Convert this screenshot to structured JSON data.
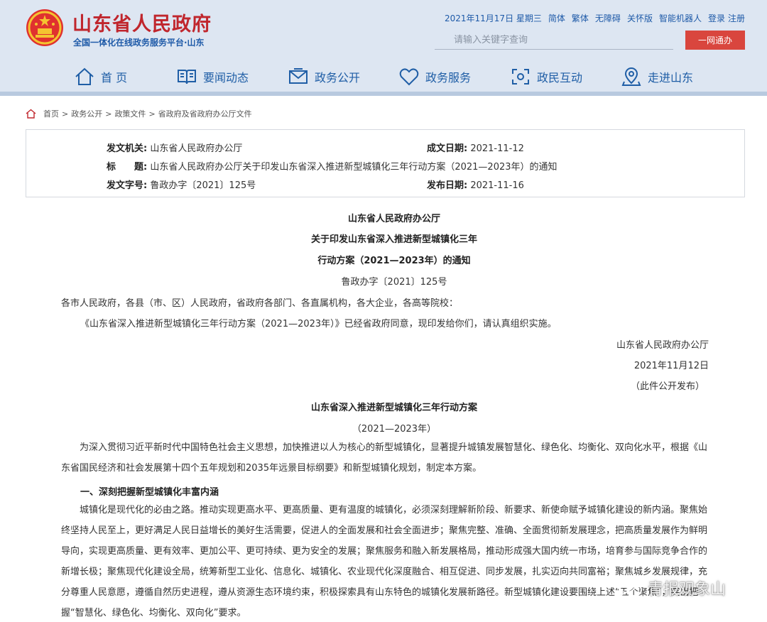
{
  "header": {
    "site_title": "山东省人民政府",
    "site_subtitle": "全国一体化在线政务服务平台·山东",
    "date": "2021年11月17日 星期三",
    "links": [
      "简体",
      "繁体",
      "无障碍",
      "关怀版",
      "智能机器人",
      "登录",
      "注册"
    ],
    "search_placeholder": "请输入关键字查询",
    "yiwang_label": "一网通办"
  },
  "nav": {
    "items": [
      {
        "label": "首 页",
        "icon": "home-icon"
      },
      {
        "label": "要闻动态",
        "icon": "book-icon"
      },
      {
        "label": "政务公开",
        "icon": "envelope-icon"
      },
      {
        "label": "政务服务",
        "icon": "heart-icon"
      },
      {
        "label": "政民互动",
        "icon": "interaction-icon"
      },
      {
        "label": "走进山东",
        "icon": "location-pin-icon"
      }
    ]
  },
  "breadcrumb": [
    "首页",
    "政务公开",
    "政策文件",
    "省政府及省政府办公厅文件"
  ],
  "breadcrumb_sep": ">",
  "info": {
    "issuer_label": "发文机关:",
    "issuer": "山东省人民政府办公厅",
    "date_label": "成文日期:",
    "date": "2021-11-12",
    "title_label": "标　　题:",
    "title": "山东省人民政府办公厅关于印发山东省深入推进新型城镇化三年行动方案（2021—2023年）的通知",
    "number_label": "发文字号:",
    "number": "鲁政办字〔2021〕125号",
    "publish_label": "发布日期:",
    "publish_date": "2021-11-16"
  },
  "document": {
    "heading1": "山东省人民政府办公厅",
    "heading2": "关于印发山东省深入推进新型城镇化三年",
    "heading3": "行动方案（2021—2023年）的通知",
    "doc_number": "鲁政办字〔2021〕125号",
    "recipients": "各市人民政府，各县（市、区）人民政府，省政府各部门、各直属机构，各大企业，各高等院校：",
    "notice": "《山东省深入推进新型城镇化三年行动方案（2021—2023年）》已经省政府同意，现印发给你们，请认真组织实施。",
    "signature": "山东省人民政府办公厅",
    "sign_date": "2021年11月12日",
    "public_note": "（此件公开发布）",
    "plan_title": "山东省深入推进新型城镇化三年行动方案",
    "plan_years": "（2021—2023年）",
    "intro": "为深入贯彻习近平新时代中国特色社会主义思想，加快推进以人为核心的新型城镇化，显著提升城镇发展智慧化、绿色化、均衡化、双向化水平，根据《山东省国民经济和社会发展第十四个五年规划和2035年远景目标纲要》和新型城镇化规划，制定本方案。",
    "section1": "一、深刻把握新型城镇化丰富内涵",
    "section1_body": "城镇化是现代化的必由之路。推动实现更高水平、更高质量、更有温度的城镇化，必须深刻理解新阶段、新要求、新使命赋予城镇化建设的新内涵。聚焦始终坚持人民至上，更好满足人民日益增长的美好生活需要，促进人的全面发展和社会全面进步；聚焦完整、准确、全面贯彻新发展理念，把高质量发展作为鲜明导向，实现更高质量、更有效率、更加公平、更可持续、更为安全的发展；聚焦服务和融入新发展格局，推动形成强大国内统一市场，培育参与国际竞争合作的新增长极；聚焦现代化建设全局，统筹新型工业化、信息化、城镇化、农业现代化深度融合、相互促进、同步发展，扎实迈向共同富裕；聚焦城乡发展规律，充分尊重人民意愿，遵循自然历史进程，遵从资源生态环境约束，积极探索具有山东特色的城镇化发展新路径。新型城镇化建设要围绕上述“五个聚焦”，突出把握“智慧化、绿色化、均衡化、双向化”要求。"
  },
  "watermark": {
    "text": "青报观象山",
    "icon": "wechat-icon"
  },
  "colors": {
    "brand_red": "#c0262d",
    "brand_blue": "#1e5aa8",
    "nav_blue": "#1f5ea6",
    "header_bg": "#dde6f2",
    "button_red": "#d9463e"
  }
}
